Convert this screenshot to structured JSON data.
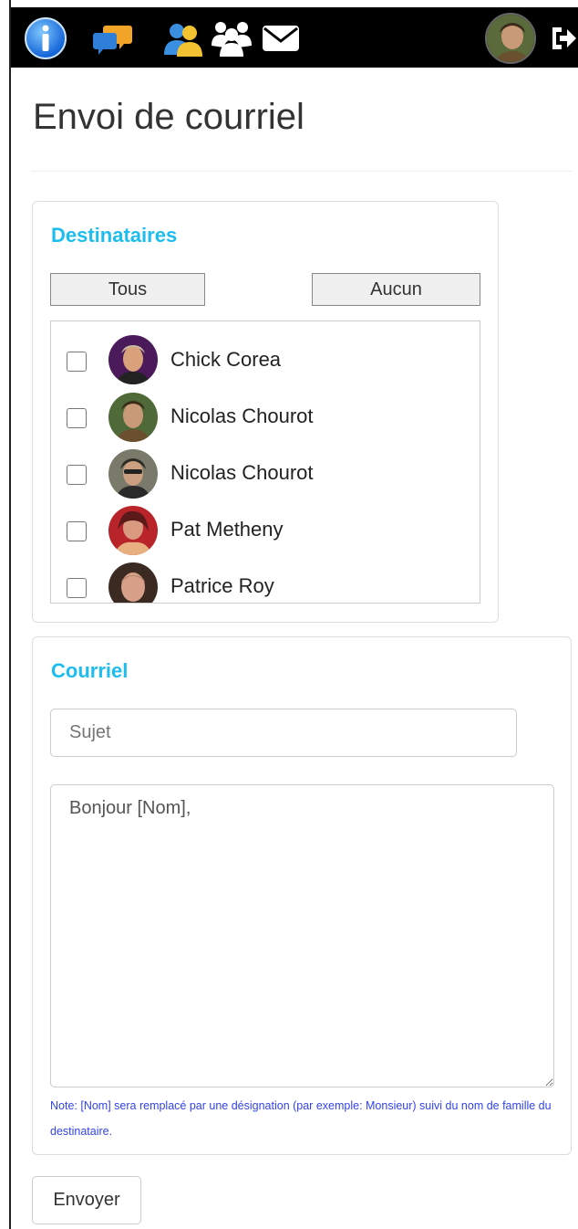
{
  "nav": {
    "icons": [
      "info-icon",
      "chat-icon",
      "user-icon",
      "group-icon",
      "mail-icon"
    ],
    "logout_icon": "logout-icon"
  },
  "page": {
    "title": "Envoi de courriel"
  },
  "recipients": {
    "title": "Destinataires",
    "all_label": "Tous",
    "none_label": "Aucun",
    "items": [
      {
        "name": "Chick Corea",
        "checked": false
      },
      {
        "name": "Nicolas Chourot",
        "checked": false
      },
      {
        "name": "Nicolas Chourot",
        "checked": false
      },
      {
        "name": "Pat Metheny",
        "checked": false
      },
      {
        "name": "Patrice Roy",
        "checked": false
      }
    ]
  },
  "email": {
    "title": "Courriel",
    "subject_placeholder": "Sujet",
    "subject_value": "",
    "body_value": "Bonjour [Nom],",
    "note": "Note: [Nom] sera remplacé par une désignation (par exemple: Monsieur) suivi du nom de famille du destinataire."
  },
  "send_label": "Envoyer",
  "colors": {
    "accent": "#1ebdf0",
    "note": "#3344ee",
    "topbar": "#000000"
  }
}
